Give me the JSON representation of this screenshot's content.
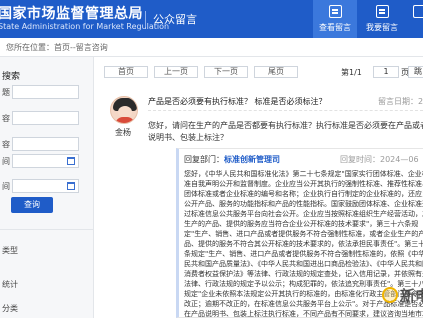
{
  "header": {
    "title": "国家市场监督管理总局",
    "subtitle": "State Administration for Market Regulation",
    "section": "公众留言",
    "tabs": [
      {
        "label": "查看留言",
        "icon": "message-list-icon",
        "active": true
      },
      {
        "label": "我要留言",
        "icon": "compose-icon",
        "active": false
      }
    ]
  },
  "breadcrumb": "您所在位置：首页--留言咨询",
  "sidebar": {
    "title": "搜索",
    "fields": [
      {
        "label": "题",
        "value": ""
      },
      {
        "label": "容",
        "value": ""
      },
      {
        "label": "容",
        "value": ""
      },
      {
        "label": "间",
        "value": ""
      },
      {
        "label": "间",
        "value": ""
      }
    ],
    "search_button": "查询",
    "extra_items": [
      "类型",
      "统计",
      "分类"
    ]
  },
  "pager": {
    "first": "首页",
    "prev": "上一页",
    "next": "下一页",
    "last": "尾页",
    "page_info": "第1/1",
    "goto_label": "页",
    "goto_value": "1",
    "go": "跳"
  },
  "message": {
    "username": "金杨",
    "title": "产品是否必须要有执行标准？ 标准是否必须标注？",
    "time_label": "留言日期：2024-",
    "body": "您好，请问在生产的产品是否都要有执行标准？执行标准是否必须要在产品或者说明书、包装上标注？"
  },
  "reply": {
    "dept_label": "回复部门：",
    "dept": "标准创新管理司",
    "time_label": "回复时间：2024—06",
    "body": "您好，《中华人民共和国标准化法》第二十七条规定\"国家实行团体标准、企业标准自我声明公开和监督制度。企业应当公开其执行的强制性标准、推荐性标准、团体标准或者企业标准的编号和名称；企业执行自行制定的企业标准的，还应当公开产品、服务的功能指标和产品的性能指标。国家鼓励团体标准、企业标准通过标准信息公共服务平台向社会公开。企业应当按照标准组织生产经营活动，其生产的产品、提供的服务应当符合企业公开标准的技术要求\"，第三十六条规定\"生产、销售、进口产品或者提供服务不符合强制性标准，或者企业生产的产品、提供的服务不符合其公开标准的技术要求的，依法承担民事责任\"。第三十七条规定\"生产、销售、进口产品或者提供服务不符合强制性标准的，依照《中华人民共和国产品质量法》、《中华人民共和国进出口商品检验法》、《中华人民共和国消费者权益保护法》等法律、行政法规的规定查处，记入信用记录，并依照有关法律、行政法规的规定予以公示；构成犯罪的，依法追究刑事责任\"。第三十八条规定\"企业未依照本法规定公开其执行的标准的，由标准化行政主管部门责令限期改正；逾期不改正的，在标准信息公共服务平台上公示\"。对于产品标准是否必须在产品说明书、包装上标注执行标准，不同产品有不同要求，建议咨询当地市场监管部门。"
  },
  "watermark": "新电"
}
